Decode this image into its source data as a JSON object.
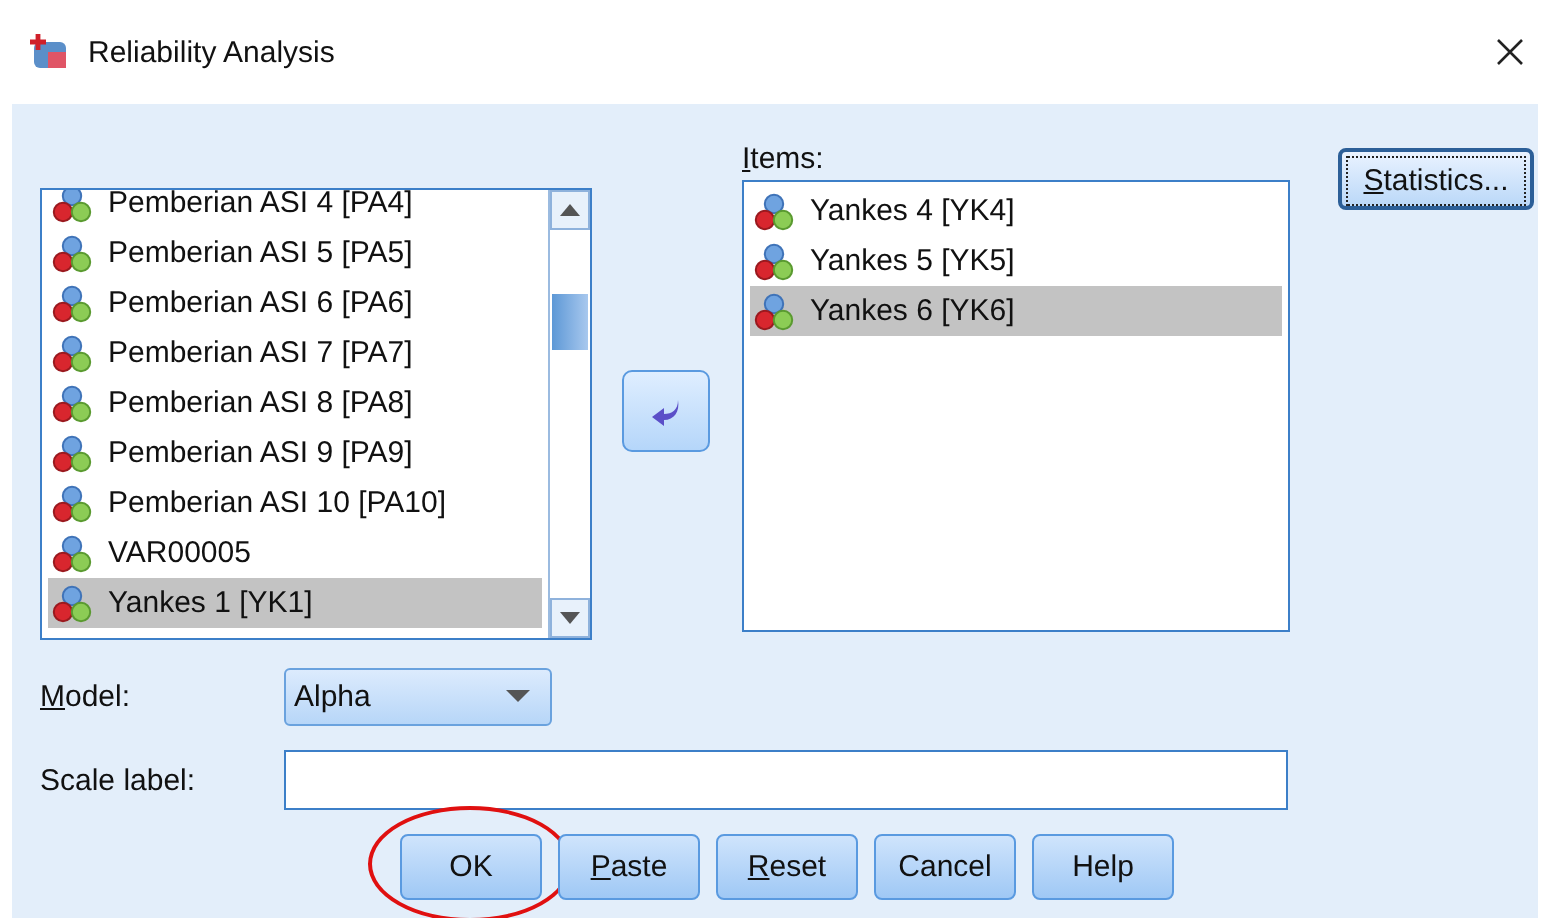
{
  "window": {
    "title": "Reliability Analysis"
  },
  "variables": {
    "items": [
      {
        "label": "Pemberian ASI 4 [PA4]",
        "selected": false
      },
      {
        "label": "Pemberian ASI 5 [PA5]",
        "selected": false
      },
      {
        "label": "Pemberian ASI 6 [PA6]",
        "selected": false
      },
      {
        "label": "Pemberian ASI 7 [PA7]",
        "selected": false
      },
      {
        "label": "Pemberian ASI 8 [PA8]",
        "selected": false
      },
      {
        "label": "Pemberian ASI 9 [PA9]",
        "selected": false
      },
      {
        "label": "Pemberian ASI 10 [PA10]",
        "selected": false
      },
      {
        "label": "VAR00005",
        "selected": false
      },
      {
        "label": "Yankes 1 [YK1]",
        "selected": true
      }
    ]
  },
  "items_list": {
    "label": "Items:",
    "underline_first": true,
    "items": [
      {
        "label": "Yankes 4 [YK4]",
        "selected": false
      },
      {
        "label": "Yankes 5 [YK5]",
        "selected": false
      },
      {
        "label": "Yankes 6 [YK6]",
        "selected": true
      }
    ]
  },
  "statistics_button": {
    "label": "Statistics...",
    "underline_first": true,
    "focused": true
  },
  "model": {
    "label": "Model:",
    "underline_first": true,
    "value": "Alpha"
  },
  "scale_label": {
    "label": "Scale label:",
    "underline_first": false
  },
  "buttons": [
    {
      "label": "OK",
      "underline_first": false,
      "circled": true
    },
    {
      "label": "Paste",
      "underline_first": true,
      "circled": false
    },
    {
      "label": "Reset",
      "underline_first": true,
      "circled": false
    },
    {
      "label": "Cancel",
      "underline_first": false,
      "circled": false
    },
    {
      "label": "Help",
      "underline_first": false,
      "circled": false
    }
  ]
}
